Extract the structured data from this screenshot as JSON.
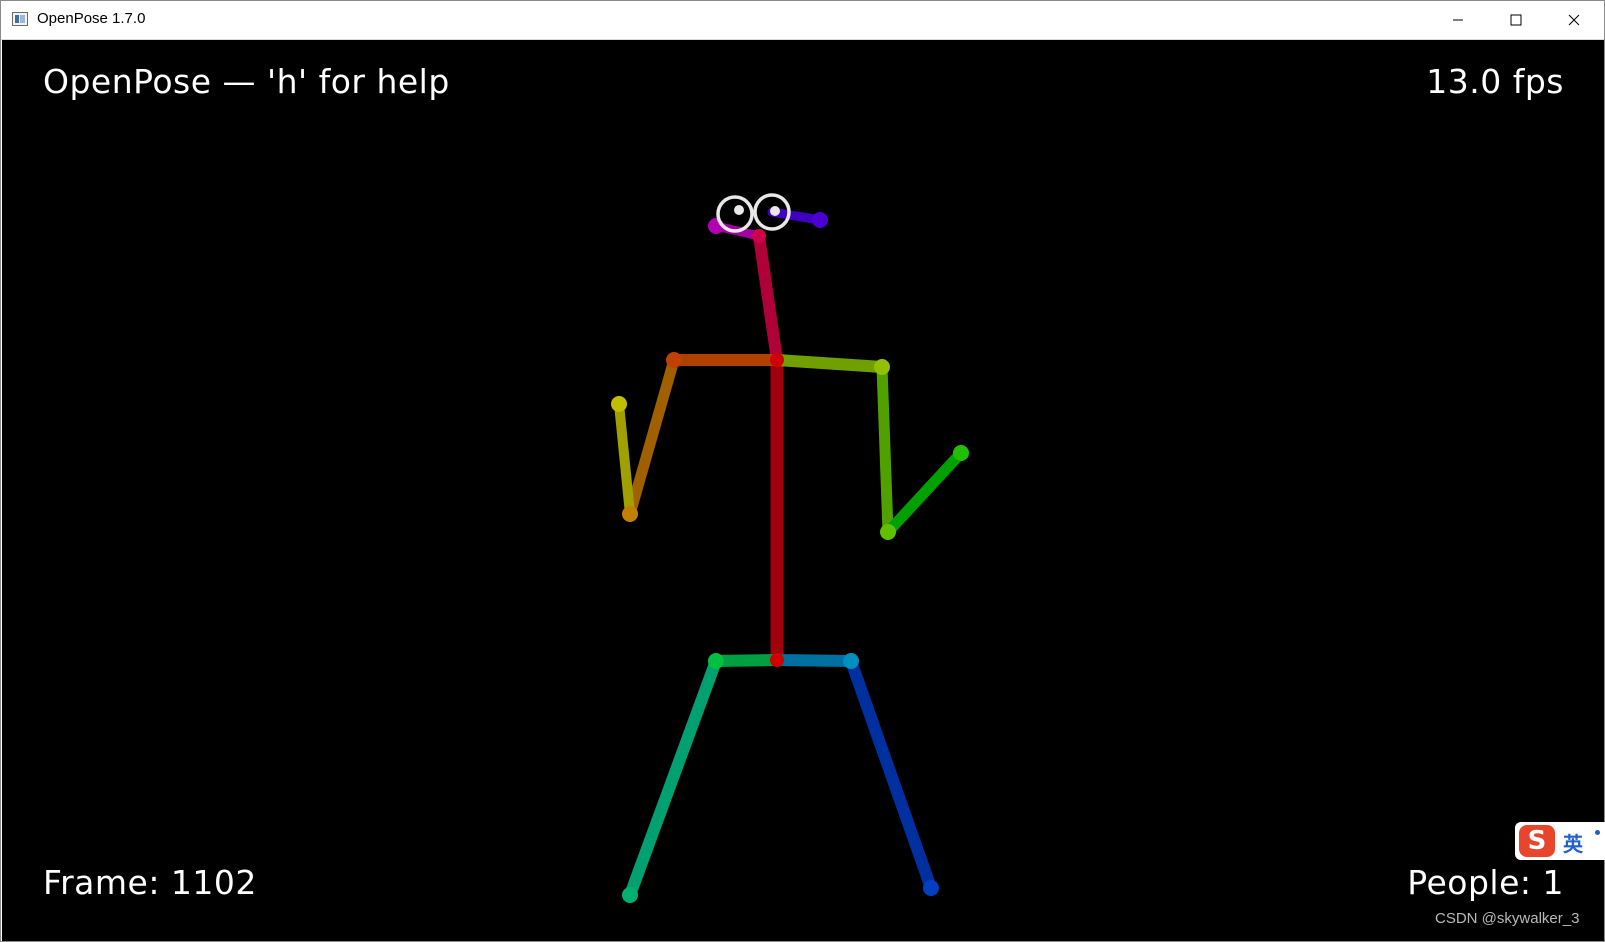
{
  "window": {
    "title": "OpenPose 1.7.0",
    "icons": {
      "app": "app-window-icon",
      "minimize": "minimize-icon",
      "maximize": "maximize-icon",
      "close": "close-icon"
    }
  },
  "overlay": {
    "help_text": "OpenPose — 'h' for help",
    "fps_text": "13.0 fps",
    "frame_text": "Frame: 1102",
    "people_text": "People: 1"
  },
  "ime": {
    "logo": "S",
    "lang": "英"
  },
  "watermark": "CSDN @skywalker_3",
  "colors": {
    "canvas_bg": "#000000",
    "overlay_text": "#ffffff",
    "torso": "#a0000a",
    "neck": "#b0003a",
    "right_shoulder": "#b04000",
    "right_upper_arm": "#a06000",
    "right_forearm": "#a0a000",
    "left_shoulder": "#70a000",
    "left_upper_arm": "#50a000",
    "left_forearm": "#00a000",
    "right_hip": "#00a040",
    "right_thigh": "#00a070",
    "left_hip": "#0070a0",
    "left_thigh": "#0030a0"
  }
}
